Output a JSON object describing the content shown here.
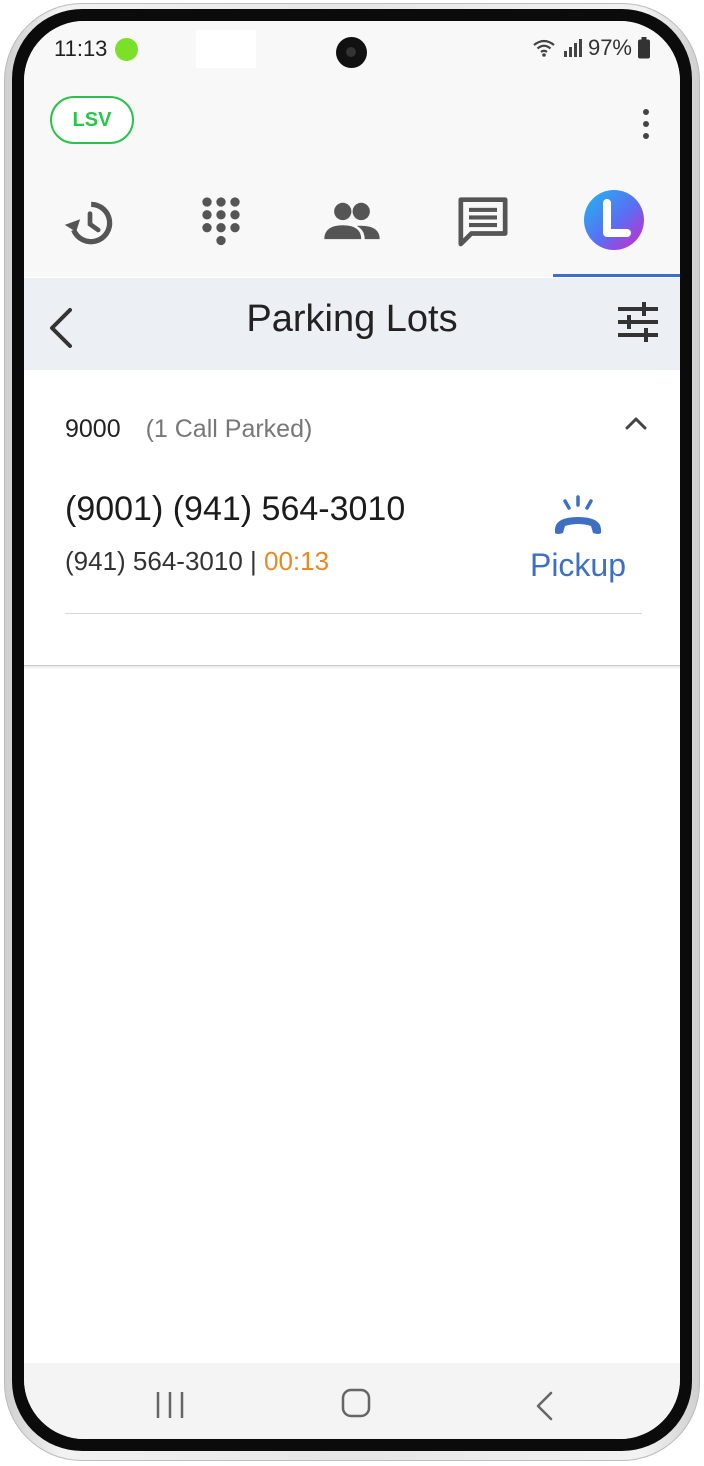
{
  "status_bar": {
    "time": "11:13",
    "battery_percent": "97%",
    "icons": [
      "wifi-icon",
      "signal-icon",
      "battery-icon"
    ]
  },
  "header": {
    "badge_label": "LSV",
    "menu_icon": "more-vert-icon"
  },
  "tabs": [
    {
      "name": "recents",
      "icon": "history-icon",
      "active": false
    },
    {
      "name": "dialpad",
      "icon": "dialpad-icon",
      "active": false
    },
    {
      "name": "contacts",
      "icon": "people-icon",
      "active": false
    },
    {
      "name": "messages",
      "icon": "chat-icon",
      "active": false
    },
    {
      "name": "app",
      "icon": "app-logo-icon",
      "active": true
    }
  ],
  "title_bar": {
    "title": "Parking Lots"
  },
  "parking_lot": {
    "number": "9000",
    "summary": "(1 Call Parked)",
    "calls": [
      {
        "name": "(9001) (941) 564-3010",
        "number": "(941) 564-3010",
        "separator": " | ",
        "duration": "00:13",
        "action_label": "Pickup"
      }
    ]
  },
  "colors": {
    "accent_blue": "#3d6fc2",
    "timer_orange": "#e88a1f",
    "badge_green": "#28c74b",
    "title_bar_bg": "#eceff4"
  }
}
